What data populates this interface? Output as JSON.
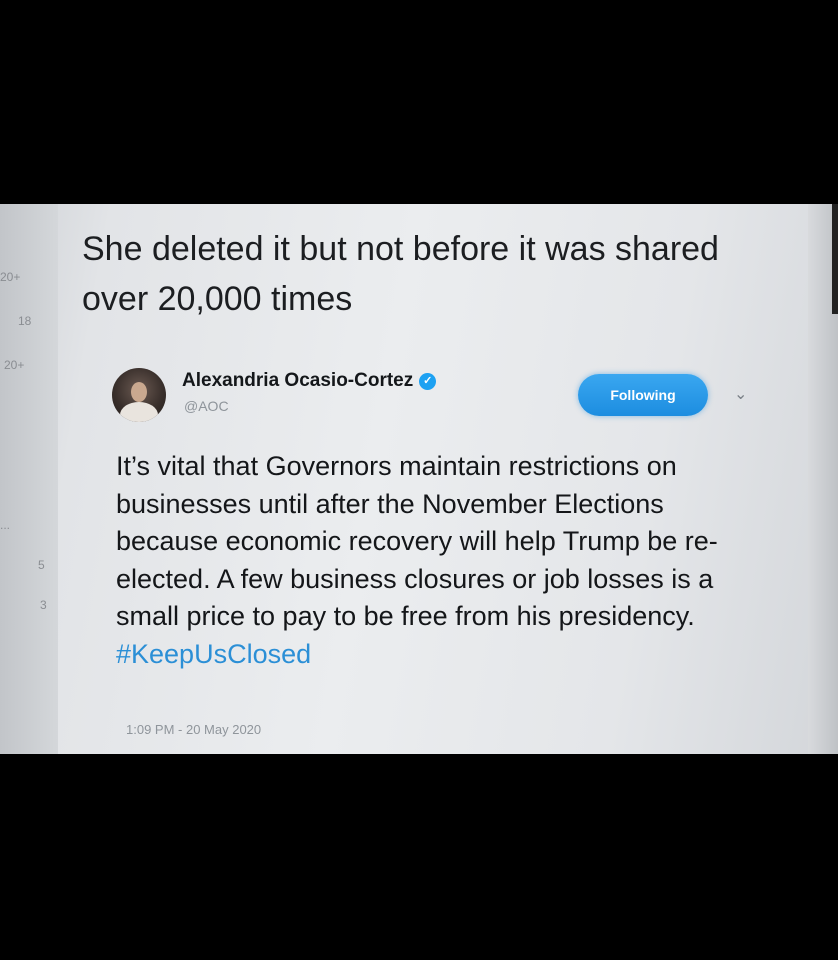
{
  "post": {
    "text": "She deleted it but not before it was shared over 20,000 times"
  },
  "gutter": {
    "numbers": [
      "20+",
      "18",
      "20+",
      "...",
      "5",
      "3"
    ]
  },
  "tweet": {
    "author_name": "Alexandria Ocasio-Cortez",
    "handle": "@AOC",
    "follow_label": "Following",
    "body_text": "It’s vital that Governors maintain restrictions on businesses until after the November Elections because economic recovery will help Trump be re-elected. A few business closures or job losses is a small price to pay to be free from his presidency. ",
    "hashtag": "#KeepUsClosed",
    "timestamp": "1:09 PM - 20 May 2020",
    "verified_icon": "verified-badge",
    "menu_icon": "chevron-down"
  },
  "colors": {
    "accent": "#1da1f2",
    "hashtag": "#2b8fd6"
  }
}
